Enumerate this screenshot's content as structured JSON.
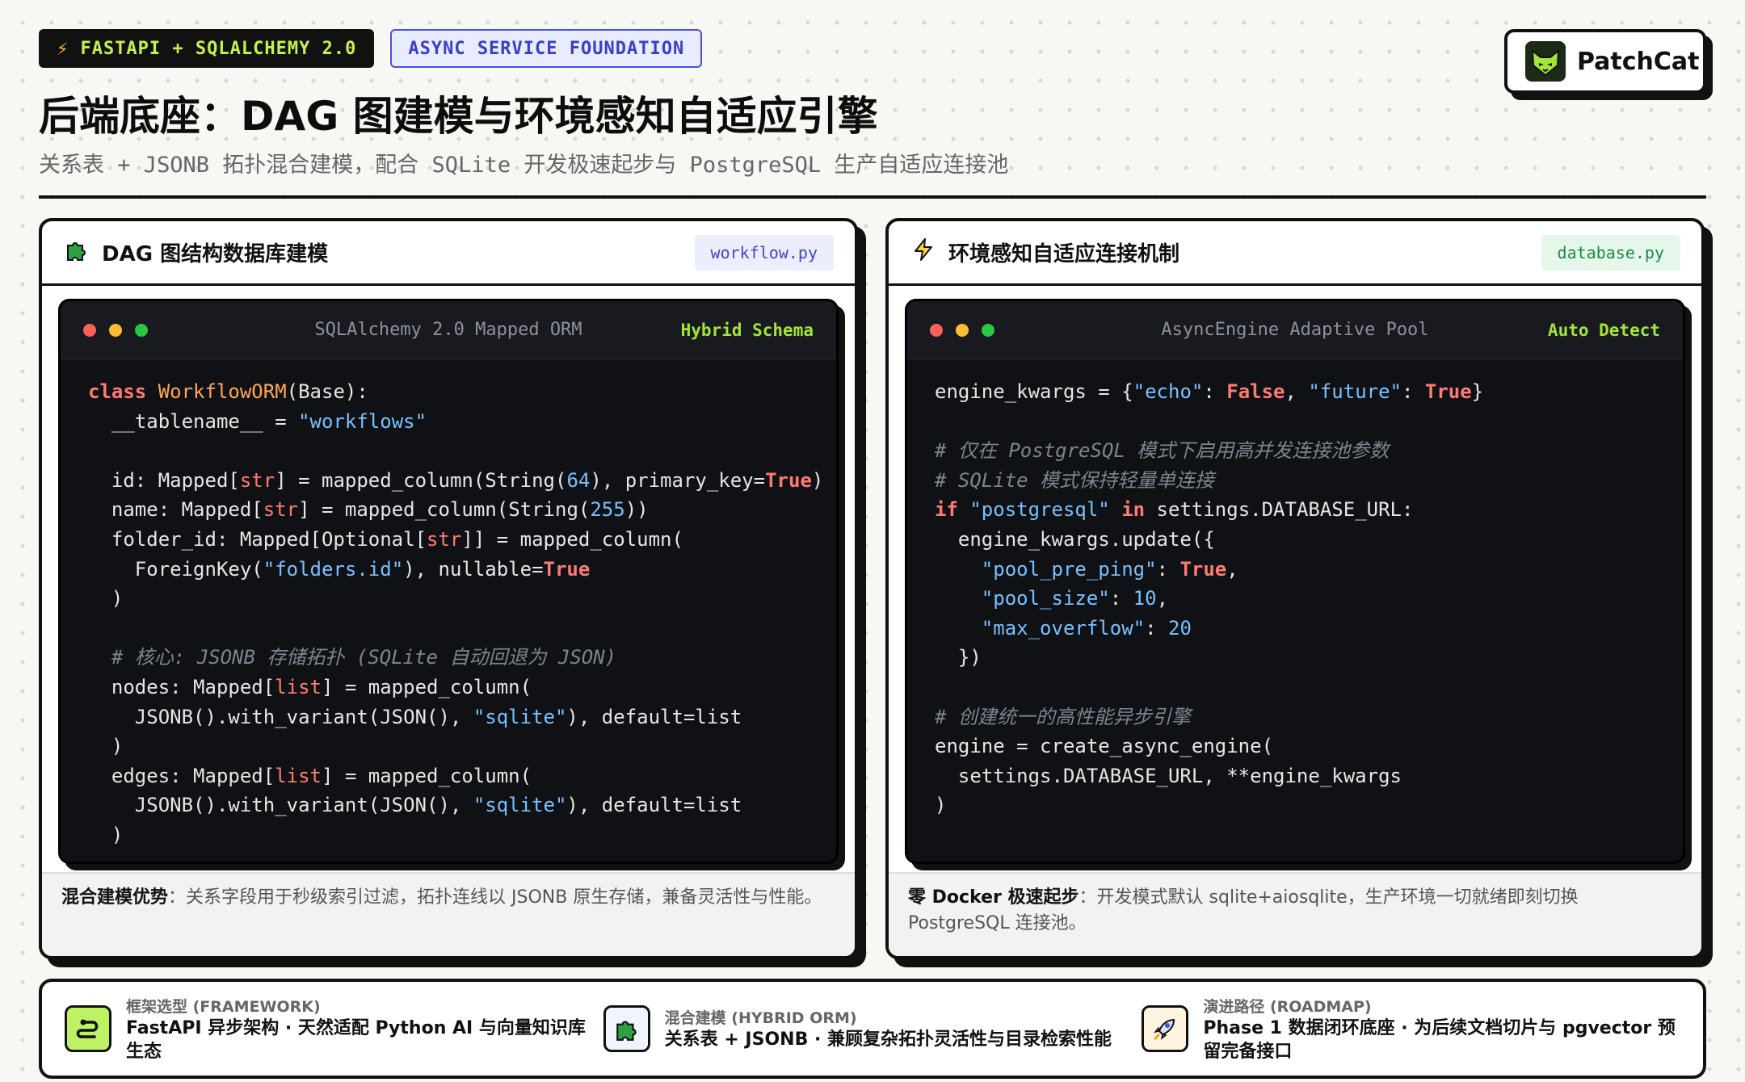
{
  "header": {
    "badge_primary": "FASTAPI + SQLALCHEMY 2.0",
    "badge_secondary": "ASYNC SERVICE FOUNDATION",
    "title": "后端底座：DAG 图建模与环境感知自适应引擎",
    "subtitle": "关系表 + JSONB 拓扑混合建模，配合 SQLite 开发极速起步与 PostgreSQL 生产自适应连接池"
  },
  "brand": {
    "name": "PatchCat",
    "icon": "fox-logo-icon",
    "accent": "#a3e635"
  },
  "panels": {
    "left": {
      "icon": "puzzle-icon",
      "title": "DAG 图结构数据库建模",
      "file": "workflow.py",
      "window_title": "SQLAlchemy 2.0 Mapped ORM",
      "window_tag": "Hybrid Schema",
      "note_label": "混合建模优势",
      "note_text": "：关系字段用于秒级索引过滤，拓扑连线以 JSONB 原生存储，兼备灵活性与性能。"
    },
    "right": {
      "icon": "lightning-icon",
      "title": "环境感知自适应连接机制",
      "file": "database.py",
      "window_title": "AsyncEngine Adaptive Pool",
      "window_tag": "Auto Detect",
      "note_label": "零 Docker 极速起步",
      "note_text": "：开发模式默认 sqlite+aiosqlite，生产环境一切就绪即刻切换 PostgreSQL 连接池。"
    }
  },
  "features": [
    {
      "icon": "snake-icon",
      "label": "框架选型 (FRAMEWORK)",
      "desc": "FastAPI 异步架构 · 天然适配 Python AI 与向量知识库生态"
    },
    {
      "icon": "puzzle-icon",
      "label": "混合建模 (HYBRID ORM)",
      "desc": "关系表 + JSONB · 兼顾复杂拓扑灵活性与目录检索性能"
    },
    {
      "icon": "rocket-icon",
      "label": "演进路径 (ROADMAP)",
      "desc": "Phase 1 数据闭环底座 · 为后续文档切片与 pgvector 预留完备接口"
    }
  ],
  "colors": {
    "badge_dark_text": "#c6f24e",
    "badge_light_text": "#3a3fc6",
    "code_bg": "#0f1115",
    "keyword": "#ff7b72",
    "string": "#79c0ff",
    "tag_green": "#a3e635"
  }
}
